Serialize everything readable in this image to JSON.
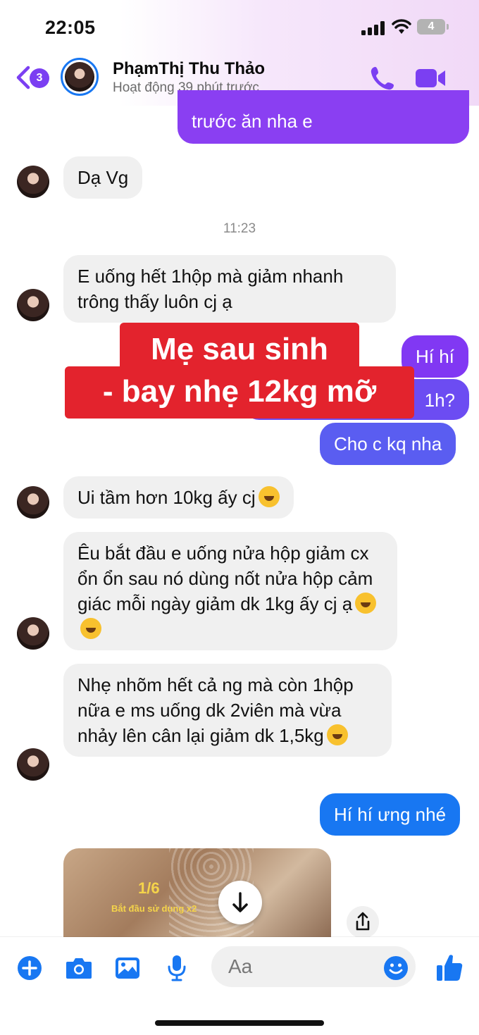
{
  "status_bar": {
    "time": "22:05",
    "battery": "4"
  },
  "header": {
    "back_badge": "3",
    "contact_name": "PhạmThị Thu Thảo",
    "contact_status": "Hoạt động 39 phút trước"
  },
  "messages": [
    {
      "id": "m1",
      "side": "out",
      "text": "trước ăn nha e"
    },
    {
      "id": "m2",
      "side": "in",
      "text": "Dạ Vg"
    },
    {
      "id": "ts1",
      "text": "11:23"
    },
    {
      "id": "m3",
      "side": "in",
      "text": "E uống hết 1hộp mà giảm nhanh trông thấy luôn cj ạ"
    },
    {
      "id": "m4",
      "side": "out",
      "text": "Hí hí"
    },
    {
      "id": "m5",
      "side": "out",
      "text": "1h?"
    },
    {
      "id": "m6",
      "side": "out",
      "text": "Cho c kq nha"
    },
    {
      "id": "m7",
      "side": "in",
      "text": "Ui tầm hơn 10kg ấy cj"
    },
    {
      "id": "m8",
      "side": "in",
      "text": "Êu bắt đầu e uống nửa hộp giảm cx ổn ổn sau nó dùng nốt nửa hộp cảm giác mỗi ngày giảm dk 1kg ấy cj ạ"
    },
    {
      "id": "m9",
      "side": "in",
      "text": "Nhẹ nhõm hết cả ng mà còn 1hộp nữa e ms uống dk 2viên mà vừa nhảy lên cân lại giảm dk 1,5kg"
    },
    {
      "id": "m10",
      "side": "out",
      "text": "Hí hí ưng nhé"
    }
  ],
  "promo": {
    "line1": "Mẹ sau sinh",
    "line2": "- bay nhẹ 12kg mỡ"
  },
  "image_message": {
    "counter": "1/6",
    "caption": "Bắt đầu sử dụng x2"
  },
  "composer": {
    "placeholder": "Aa"
  },
  "colors": {
    "outgoing_blue": "#1877f2",
    "outgoing_purple": "#8a3ff2",
    "incoming": "#f0f0f0",
    "promo_red": "#e3232d"
  },
  "icons": [
    "back-chevron-icon",
    "phone-icon",
    "video-camera-icon",
    "plus-icon",
    "camera-icon",
    "gallery-icon",
    "microphone-icon",
    "emoji-icon",
    "thumbs-up-icon",
    "download-arrow-icon",
    "share-icon"
  ]
}
